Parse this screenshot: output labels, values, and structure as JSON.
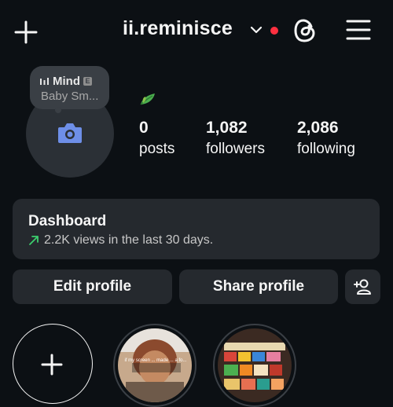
{
  "header": {
    "username": "ii.reminisce",
    "icons": [
      "plus-icon",
      "chevron-down-icon",
      "threads-icon",
      "menu-icon"
    ],
    "notification_dot_color": "#ff3040"
  },
  "note": {
    "music_title": "Mind",
    "explicit_badge": "E",
    "artist": "Baby Sm..."
  },
  "stats": [
    {
      "value": "0",
      "label": "posts"
    },
    {
      "value": "1,082",
      "label": "followers"
    },
    {
      "value": "2,086",
      "label": "following"
    }
  ],
  "dashboard": {
    "title": "Dashboard",
    "subtitle": "2.2K views in the last 30 days.",
    "trend_color": "#3ccf6e"
  },
  "actions": {
    "edit": "Edit profile",
    "share": "Share profile"
  },
  "highlights": {
    "story_caption": "if my screen ... made ... a fo..."
  }
}
